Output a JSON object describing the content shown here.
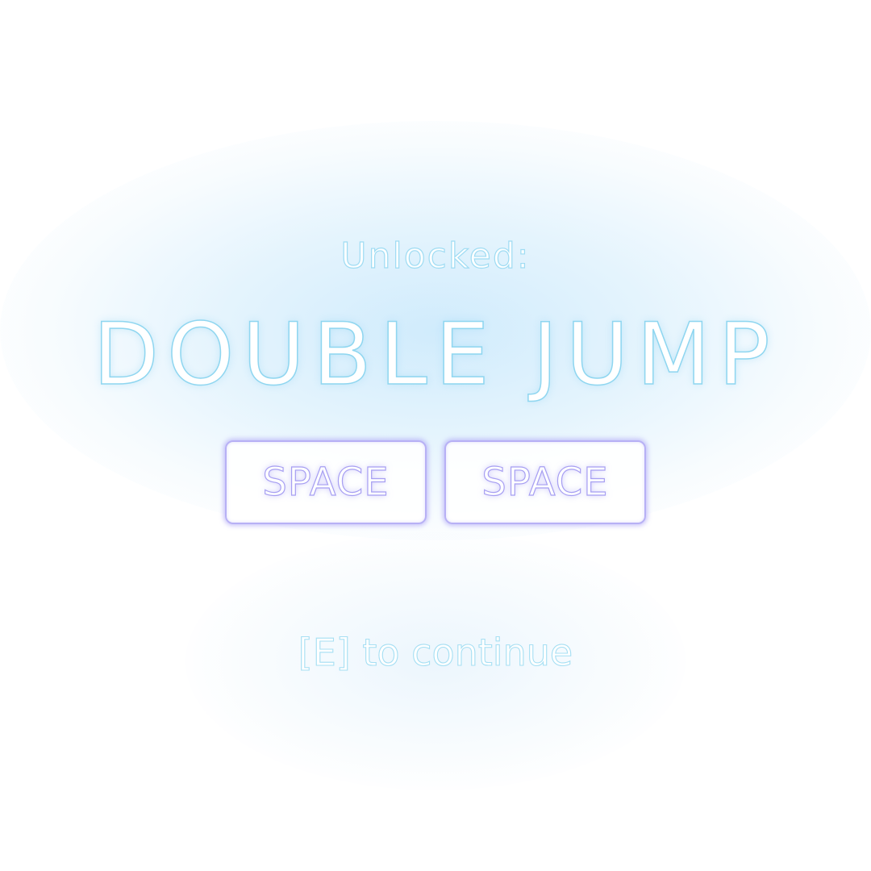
{
  "unlock_popup": {
    "label": "Unlocked:",
    "ability_name": "DOUBLE JUMP",
    "keys": [
      {
        "label": "SPACE"
      },
      {
        "label": "SPACE"
      }
    ],
    "continue_prompt": "[E] to continue"
  },
  "colors": {
    "background": "#ffffff",
    "glow": "#c8e8fc",
    "text_outline_cyan": "#8fd6f0",
    "key_outline_purple": "#b7b0f5"
  }
}
